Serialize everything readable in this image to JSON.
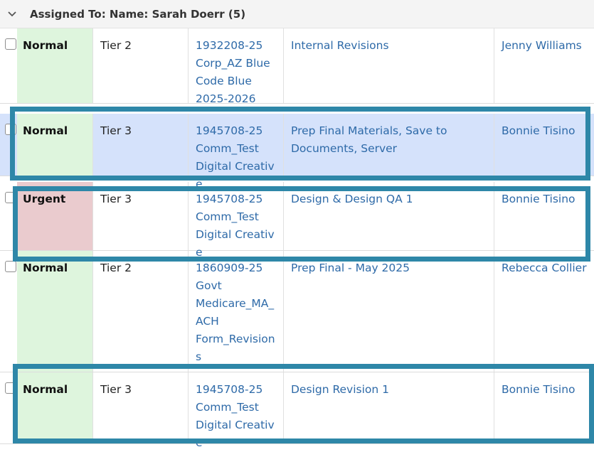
{
  "group": {
    "label": "Assigned To: Name: Sarah Doerr (5)"
  },
  "rows": [
    {
      "priority": "Normal",
      "priority_color": "#def5dd",
      "tier": "Tier 2",
      "project_lines": [
        "1932208-25",
        "Corp_AZ Blue",
        "Code Blue",
        "2025-2026"
      ],
      "task": "Internal Revisions",
      "assignee": "Jenny Williams"
    },
    {
      "priority": "Normal",
      "priority_color": "#def5dd",
      "tier": "Tier 3",
      "project_lines": [
        "1945708-25",
        "Comm_Test",
        "Digital Creative"
      ],
      "task": "Prep Final Materials, Save to Documents, Server",
      "assignee": "Bonnie Tisino",
      "selected": true
    },
    {
      "priority": "Urgent",
      "priority_color": "#eacbce",
      "tier": "Tier 3",
      "project_lines": [
        "1945708-25",
        "Comm_Test",
        "Digital Creative"
      ],
      "task": "Design & Design QA 1",
      "assignee": "Bonnie Tisino"
    },
    {
      "priority": "Normal",
      "priority_color": "#def5dd",
      "tier": "Tier 2",
      "project_lines": [
        "1860909-25",
        "Govt",
        "Medicare_MA_",
        "ACH",
        "Form_Revision",
        "s"
      ],
      "task": "Prep Final - May 2025",
      "assignee": "Rebecca Collier"
    },
    {
      "priority": "Normal",
      "priority_color": "#def5dd",
      "tier": "Tier 3",
      "project_lines": [
        "1945708-25",
        "Comm_Test",
        "Digital Creative"
      ],
      "task": "Design Revision 1",
      "assignee": "Bonnie Tisino"
    }
  ],
  "colors": {
    "link": "#2e6aa8",
    "highlight": "#2e87a8",
    "selected_row": "#d5e2fb"
  }
}
